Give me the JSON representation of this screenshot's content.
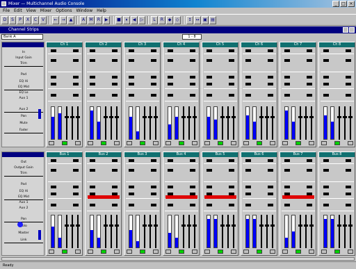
{
  "window": {
    "title": "Mixer — Multichannel Audio Console",
    "min": "_",
    "max": "□",
    "close": "×"
  },
  "menu": [
    "File",
    "Edit",
    "View",
    "Mixer",
    "Options",
    "Window",
    "Help"
  ],
  "toolbar": [
    "D",
    "S",
    "P",
    "X",
    "C",
    "V",
    "←",
    "→",
    "▲",
    "A",
    "M",
    "R",
    "▶",
    "■",
    "⏸",
    "◀",
    "▷",
    "L",
    "R",
    "◆",
    "◇",
    "↕",
    "↔",
    "▣",
    "▤"
  ],
  "subwindow": {
    "title": "Channel Strips"
  },
  "strip_combo": "Bank A",
  "pager": "1 - 8",
  "label_panel": {
    "top": [
      "In",
      "Input Gain",
      "Trim",
      "Pad",
      "EQ Hi",
      "EQ Mid",
      "EQ Lo",
      "Aux 1",
      "Aux 2",
      "Pan",
      "Mute",
      "Fader"
    ],
    "bottom": [
      "Out",
      "Output Gain",
      "Trim",
      "Pad",
      "EQ Hi",
      "EQ Mid",
      "Aux 1",
      "Aux 2",
      "Pan",
      "Solo",
      "Master",
      "Link"
    ]
  },
  "channels_top": [
    {
      "name": "Ch 1",
      "meters": [
        0.7,
        0.8
      ],
      "led": true
    },
    {
      "name": "Ch 2",
      "meters": [
        0.9,
        0.55
      ],
      "led": true
    },
    {
      "name": "Ch 3",
      "meters": [
        0.7,
        0.25
      ],
      "led": true
    },
    {
      "name": "Ch 4",
      "meters": [
        0.45,
        0.7
      ],
      "led": true
    },
    {
      "name": "Ch 5",
      "meters": [
        0.7,
        0.6
      ],
      "led": true
    },
    {
      "name": "Ch 6",
      "meters": [
        0.75,
        0.55
      ],
      "led": true
    },
    {
      "name": "Ch 7",
      "meters": [
        0.9,
        0.55
      ],
      "led": true
    },
    {
      "name": "Ch 8",
      "meters": [
        0.75,
        0.55
      ],
      "led": true
    }
  ],
  "channels_bottom": [
    {
      "name": "Bus 1",
      "meters": [
        0.65,
        0.3
      ],
      "led": true,
      "red": false
    },
    {
      "name": "Bus 2",
      "meters": [
        0.55,
        0.3
      ],
      "led": true,
      "red": true
    },
    {
      "name": "Bus 3",
      "meters": [
        0.55,
        0.2
      ],
      "led": true,
      "red": false
    },
    {
      "name": "Bus 4",
      "meters": [
        0.45,
        0.3
      ],
      "led": true,
      "red": true
    },
    {
      "name": "Bus 5",
      "meters": [
        0.9,
        0.9
      ],
      "led": true,
      "red": true
    },
    {
      "name": "Bus 6",
      "meters": [
        0.9,
        0.9
      ],
      "led": true,
      "red": false
    },
    {
      "name": "Bus 7",
      "meters": [
        0.3,
        0.5
      ],
      "led": true,
      "red": true
    },
    {
      "name": "Bus 8",
      "meters": [
        0.9,
        0.9
      ],
      "led": true,
      "red": false
    }
  ],
  "status": "Ready",
  "colors": {
    "title": "#000080",
    "channel_head": "#107070",
    "meter": "#0000ff",
    "led_on": "#00d000",
    "alert": "#e00000"
  }
}
